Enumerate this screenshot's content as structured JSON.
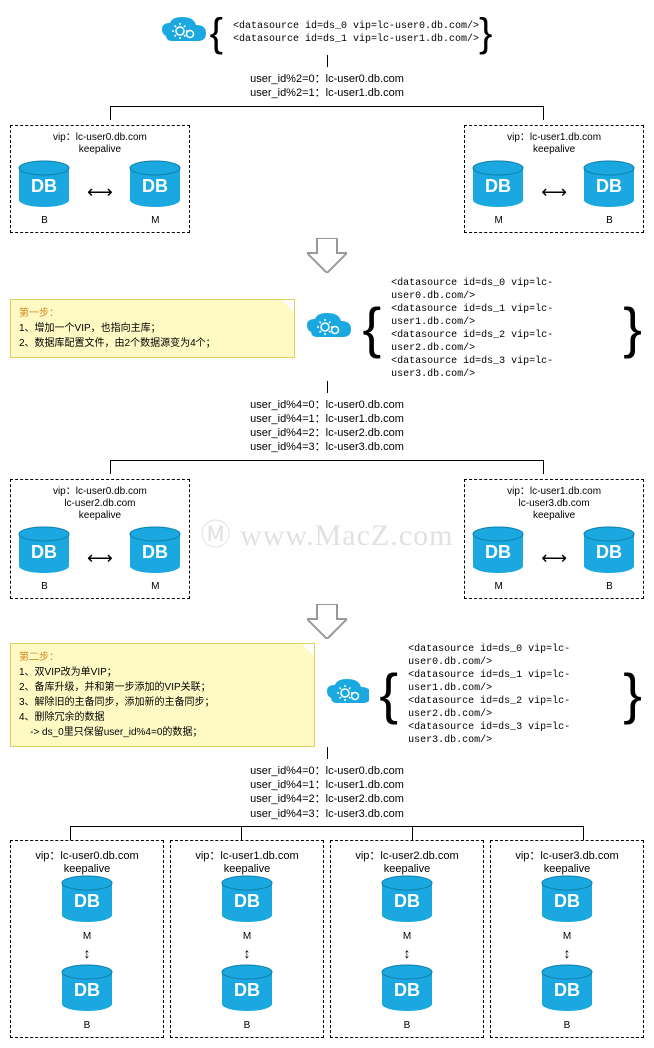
{
  "stage1": {
    "datasources": [
      "<datasource id=ds_0 vip=lc-user0.db.com/>",
      "<datasource id=ds_1 vip=lc-user1.db.com/>"
    ],
    "routing": [
      "user_id%2=0：lc-user0.db.com",
      "user_id%2=1：lc-user1.db.com"
    ],
    "left": {
      "vip": "vip：lc-user0.db.com",
      "ka": "keepalive",
      "b": "B",
      "m": "M"
    },
    "right": {
      "vip": "vip：lc-user1.db.com",
      "ka": "keepalive",
      "m": "M",
      "b": "B"
    }
  },
  "step1": {
    "title": "第一步：",
    "l1": "1、增加一个VIP，也指向主库；",
    "l2": "2、数据库配置文件，由2个数据源变为4个；"
  },
  "stage2": {
    "datasources": [
      "<datasource id=ds_0 vip=lc-user0.db.com/>",
      "<datasource id=ds_1 vip=lc-user1.db.com/>",
      "<datasource id=ds_2 vip=lc-user2.db.com/>",
      "<datasource id=ds_3 vip=lc-user3.db.com/>"
    ],
    "routing": [
      "user_id%4=0：lc-user0.db.com",
      "user_id%4=1：lc-user1.db.com",
      "user_id%4=2：lc-user2.db.com",
      "user_id%4=3：lc-user3.db.com"
    ],
    "left": {
      "vip1": "vip：lc-user0.db.com",
      "vip2": "lc-user2.db.com",
      "ka": "keepalive",
      "b": "B",
      "m": "M"
    },
    "right": {
      "vip1": "vip：lc-user1.db.com",
      "vip2": "lc-user3.db.com",
      "ka": "keepalive",
      "m": "M",
      "b": "B"
    }
  },
  "step2": {
    "title": "第二步：",
    "l1": "1、双VIP改为单VIP；",
    "l2": "2、备库升级，并和第一步添加的VIP关联；",
    "l3": "3、解除旧的主备同步，添加新的主备同步；",
    "l4": "4、删除冗余的数据",
    "l5": "    -> ds_0里只保留user_id%4=0的数据；"
  },
  "stage3": {
    "datasources": [
      "<datasource id=ds_0 vip=lc-user0.db.com/>",
      "<datasource id=ds_1 vip=lc-user1.db.com/>",
      "<datasource id=ds_2 vip=lc-user2.db.com/>",
      "<datasource id=ds_3 vip=lc-user3.db.com/>"
    ],
    "routing": [
      "user_id%4=0：lc-user0.db.com",
      "user_id%4=1：lc-user1.db.com",
      "user_id%4=2：lc-user2.db.com",
      "user_id%4=3：lc-user3.db.com"
    ],
    "nodes": [
      {
        "vip": "vip：lc-user0.db.com",
        "ka": "keepalive",
        "m": "M",
        "b": "B"
      },
      {
        "vip": "vip：lc-user1.db.com",
        "ka": "keepalive",
        "m": "M",
        "b": "B"
      },
      {
        "vip": "vip：lc-user2.db.com",
        "ka": "keepalive",
        "m": "M",
        "b": "B"
      },
      {
        "vip": "vip：lc-user3.db.com",
        "ka": "keepalive",
        "m": "M",
        "b": "B"
      }
    ]
  },
  "watermark": "Ⓜ www.MacZ.com",
  "db_label": "DB"
}
